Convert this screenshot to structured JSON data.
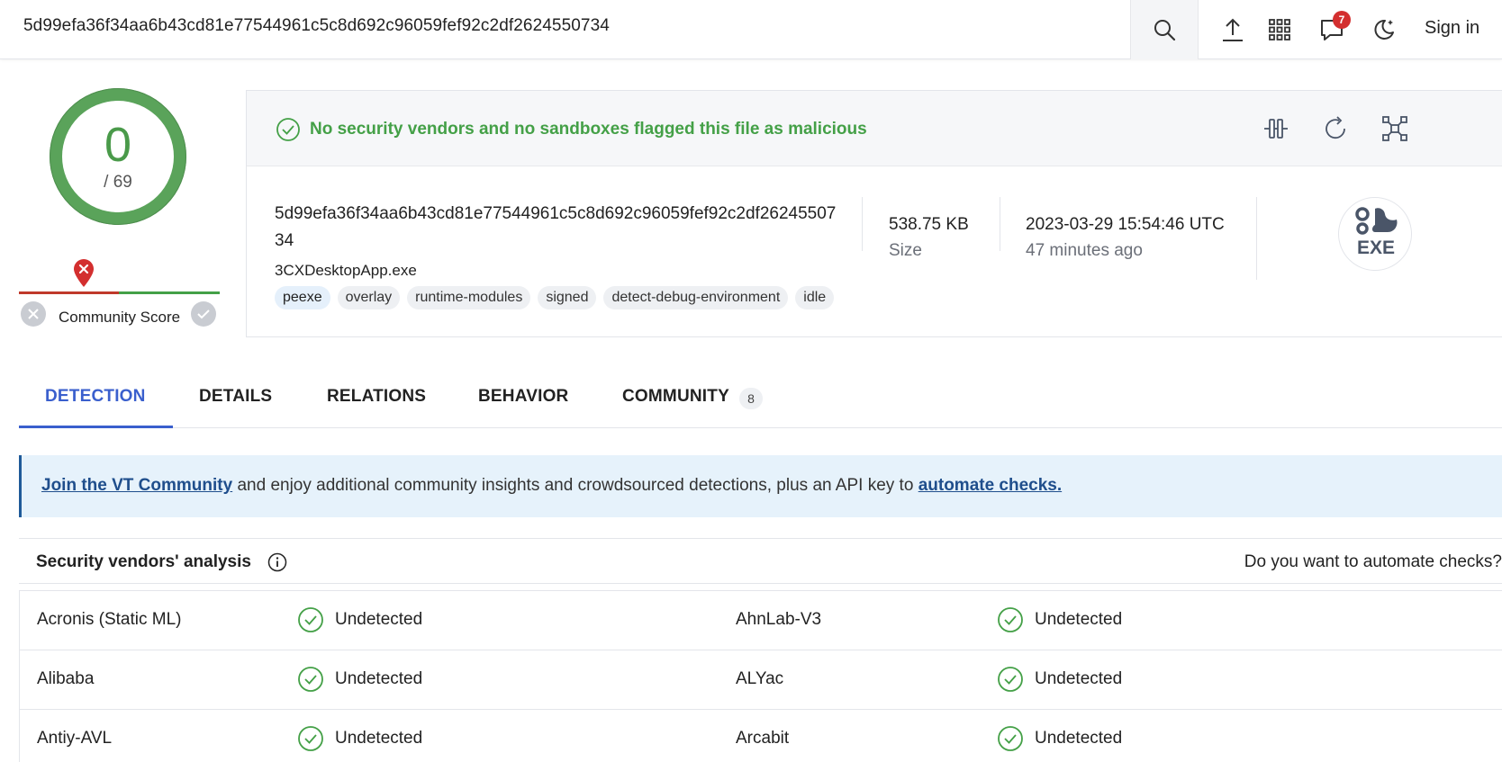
{
  "search": {
    "query": "5d99efa36f34aa6b43cd81e77544961c5c8d692c96059fef92c2df2624550734"
  },
  "topbar": {
    "notifications_count": "7",
    "signin_label": "Sign in"
  },
  "score": {
    "detections": "0",
    "total": "/ 69"
  },
  "community_score": {
    "label": "Community Score"
  },
  "summary": {
    "status": "No security vendors and no sandboxes flagged this file as malicious",
    "hash": "5d99efa36f34aa6b43cd81e77544961c5c8d692c96059fef92c2df2624550734",
    "file_name": "3CXDesktopApp.exe",
    "tags": [
      "peexe",
      "overlay",
      "runtime-modules",
      "signed",
      "detect-debug-environment",
      "idle"
    ],
    "size_value": "538.75 KB",
    "size_label": "Size",
    "date_value": "2023-03-29 15:54:46 UTC",
    "date_relative": "47 minutes ago",
    "file_type": "EXE"
  },
  "tabs": [
    {
      "label": "DETECTION"
    },
    {
      "label": "DETAILS"
    },
    {
      "label": "RELATIONS"
    },
    {
      "label": "BEHAVIOR"
    },
    {
      "label": "COMMUNITY",
      "count": "8"
    }
  ],
  "banner": {
    "link1": "Join the VT Community",
    "middle": " and enjoy additional community insights and crowdsourced detections, plus an API key to ",
    "link2": "automate checks."
  },
  "vendors": {
    "title": "Security vendors' analysis",
    "automate_link": "Do you want to automate checks?",
    "rows": [
      [
        {
          "name": "Acronis (Static ML)",
          "result": "Undetected"
        },
        {
          "name": "AhnLab-V3",
          "result": "Undetected"
        }
      ],
      [
        {
          "name": "Alibaba",
          "result": "Undetected"
        },
        {
          "name": "ALYac",
          "result": "Undetected"
        }
      ],
      [
        {
          "name": "Antiy-AVL",
          "result": "Undetected"
        },
        {
          "name": "Arcabit",
          "result": "Undetected"
        }
      ]
    ]
  },
  "colors": {
    "clean_green": "#44a047",
    "accent_blue": "#3a5fcd",
    "alert_red": "#d32f2f"
  }
}
